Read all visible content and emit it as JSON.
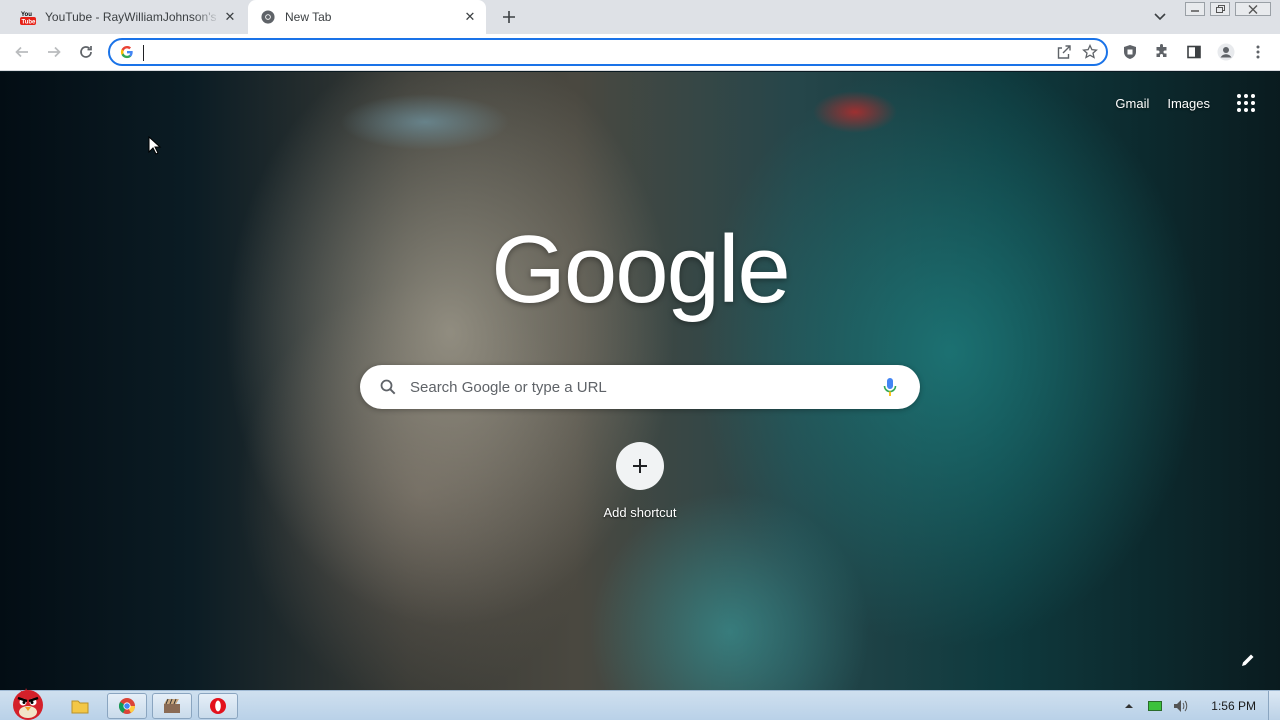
{
  "tabs": [
    {
      "title": "YouTube - RayWilliamJohnson's Channel",
      "icon": "youtube-icon",
      "active": false
    },
    {
      "title": "New Tab",
      "icon": "chrome-icon",
      "active": true
    }
  ],
  "omnibox": {
    "value": "",
    "placeholder": ""
  },
  "ntp": {
    "gmail_label": "Gmail",
    "images_label": "Images",
    "logo_text": "Google",
    "search_placeholder": "Search Google or type a URL",
    "add_shortcut_label": "Add shortcut"
  },
  "taskbar": {
    "clock": "1:56 PM"
  },
  "colors": {
    "accent": "#1a73e8",
    "tabstrip": "#dee1e6",
    "taskbar": "#c5d9ec"
  }
}
